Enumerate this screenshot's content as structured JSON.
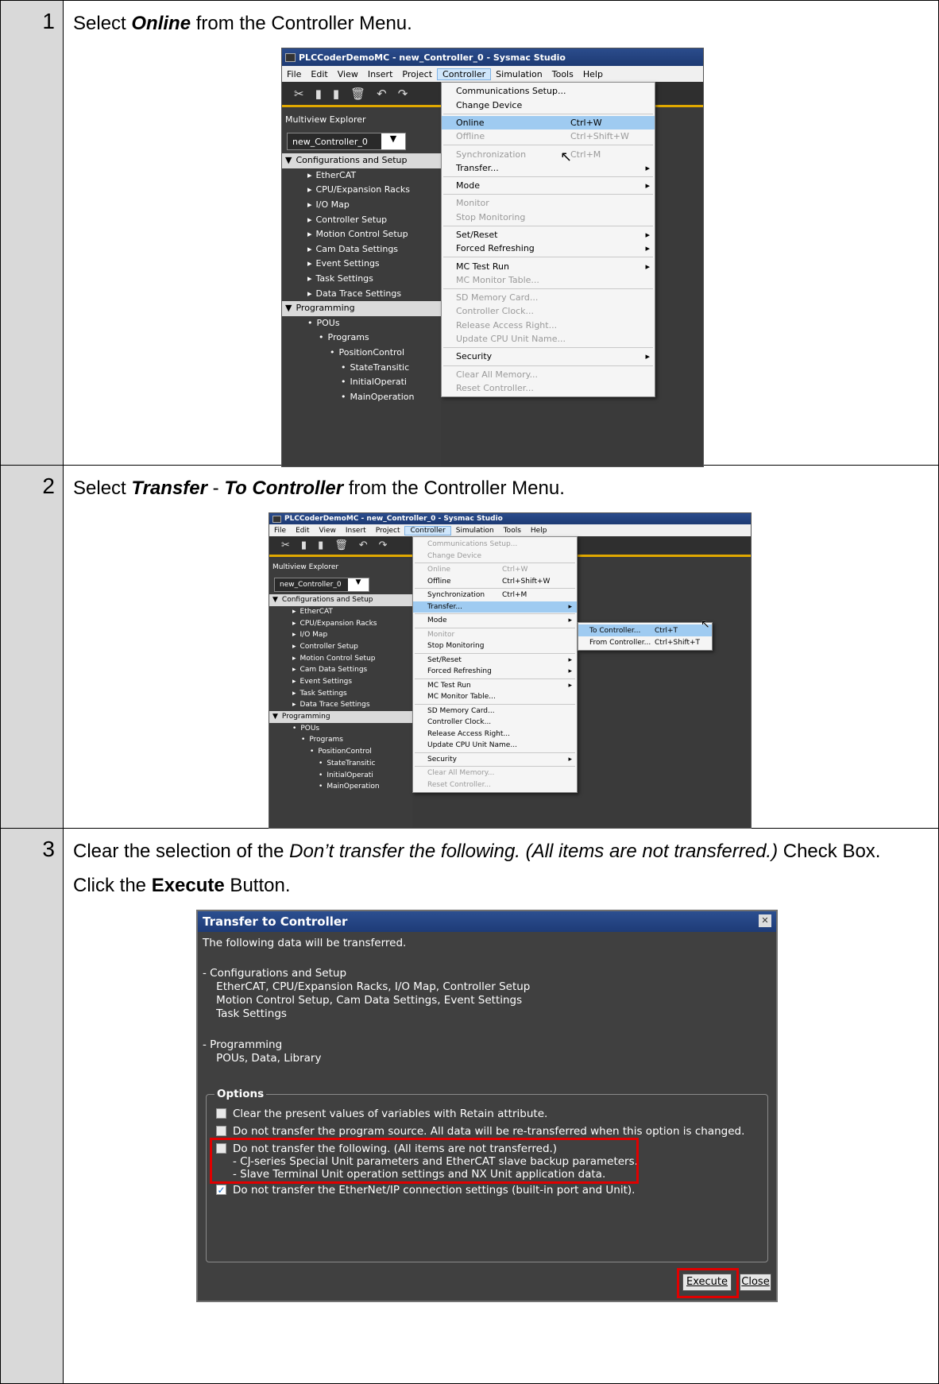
{
  "steps": [
    {
      "number": "1",
      "instruction": {
        "pre": "Select ",
        "strong": "Online",
        "post": " from the Controller Menu."
      },
      "screenshot": {
        "title": "PLCCoderDemoMC - new_Controller_0 - Sysmac Studio",
        "menubar": [
          "File",
          "Edit",
          "View",
          "Insert",
          "Project",
          "Controller",
          "Simulation",
          "Tools",
          "Help"
        ],
        "explorer_header": "Multiview Explorer",
        "combo_value": "new_Controller_0",
        "tree": [
          {
            "label": "Configurations and Setup",
            "group": true
          },
          {
            "label": "EtherCAT"
          },
          {
            "label": "CPU/Expansion Racks"
          },
          {
            "label": "I/O Map"
          },
          {
            "label": "Controller Setup"
          },
          {
            "label": "Motion Control Setup"
          },
          {
            "label": "Cam Data Settings"
          },
          {
            "label": "Event Settings"
          },
          {
            "label": "Task Settings"
          },
          {
            "label": "Data Trace Settings"
          },
          {
            "label": "Programming",
            "group": true
          },
          {
            "label": "POUs"
          },
          {
            "label": "Programs"
          },
          {
            "label": "PositionControl"
          },
          {
            "label": "StateTransitic"
          },
          {
            "label": "InitialOperati"
          },
          {
            "label": "MainOperation"
          }
        ],
        "menu": [
          {
            "label": "Communications Setup...",
            "shortcut": "",
            "state": "normal"
          },
          {
            "label": "Change Device",
            "shortcut": "",
            "state": "normal",
            "sep_after": true
          },
          {
            "label": "Online",
            "shortcut": "Ctrl+W",
            "state": "highlight"
          },
          {
            "label": "Offline",
            "shortcut": "Ctrl+Shift+W",
            "state": "disabled",
            "sep_after": true
          },
          {
            "label": "Synchronization",
            "shortcut": "Ctrl+M",
            "state": "disabled"
          },
          {
            "label": "Transfer...",
            "shortcut": "",
            "state": "normal",
            "submenu": true,
            "sep_after": true
          },
          {
            "label": "Mode",
            "shortcut": "",
            "state": "normal",
            "submenu": true,
            "sep_after": true
          },
          {
            "label": "Monitor",
            "shortcut": "",
            "state": "disabled"
          },
          {
            "label": "Stop Monitoring",
            "shortcut": "",
            "state": "disabled",
            "sep_after": true
          },
          {
            "label": "Set/Reset",
            "shortcut": "",
            "state": "normal",
            "submenu": true
          },
          {
            "label": "Forced Refreshing",
            "shortcut": "",
            "state": "normal",
            "submenu": true,
            "sep_after": true
          },
          {
            "label": "MC Test Run",
            "shortcut": "",
            "state": "normal",
            "submenu": true
          },
          {
            "label": "MC Monitor Table...",
            "shortcut": "",
            "state": "disabled",
            "sep_after": true
          },
          {
            "label": "SD Memory Card...",
            "shortcut": "",
            "state": "disabled"
          },
          {
            "label": "Controller Clock...",
            "shortcut": "",
            "state": "disabled"
          },
          {
            "label": "Release Access Right...",
            "shortcut": "",
            "state": "disabled"
          },
          {
            "label": "Update CPU Unit Name...",
            "shortcut": "",
            "state": "disabled",
            "sep_after": true
          },
          {
            "label": "Security",
            "shortcut": "",
            "state": "normal",
            "submenu": true,
            "sep_after": true
          },
          {
            "label": "Clear All Memory...",
            "shortcut": "",
            "state": "disabled"
          },
          {
            "label": "Reset Controller...",
            "shortcut": "",
            "state": "disabled"
          }
        ]
      }
    },
    {
      "number": "2",
      "instruction": {
        "pre": "Select ",
        "strong": "Transfer",
        "mid": " - ",
        "strong2": "To Controller",
        "post": " from the Controller Menu."
      },
      "screenshot": {
        "title": "PLCCoderDemoMC - new_Controller_0 - Sysmac Studio",
        "menubar": [
          "File",
          "Edit",
          "View",
          "Insert",
          "Project",
          "Controller",
          "Simulation",
          "Tools",
          "Help"
        ],
        "explorer_header": "Multiview Explorer",
        "combo_value": "new_Controller_0",
        "menu": [
          {
            "label": "Communications Setup...",
            "shortcut": "",
            "state": "disabled"
          },
          {
            "label": "Change Device",
            "shortcut": "",
            "state": "disabled",
            "sep_after": true
          },
          {
            "label": "Online",
            "shortcut": "Ctrl+W",
            "state": "disabled"
          },
          {
            "label": "Offline",
            "shortcut": "Ctrl+Shift+W",
            "state": "normal",
            "sep_after": true
          },
          {
            "label": "Synchronization",
            "shortcut": "Ctrl+M",
            "state": "normal"
          },
          {
            "label": "Transfer...",
            "shortcut": "",
            "state": "highlight",
            "submenu": true,
            "sep_after": true
          },
          {
            "label": "Mode",
            "shortcut": "",
            "state": "normal",
            "submenu": true,
            "sep_after": true
          },
          {
            "label": "Monitor",
            "shortcut": "",
            "state": "disabled"
          },
          {
            "label": "Stop Monitoring",
            "shortcut": "",
            "state": "normal",
            "sep_after": true
          },
          {
            "label": "Set/Reset",
            "shortcut": "",
            "state": "normal",
            "submenu": true
          },
          {
            "label": "Forced Refreshing",
            "shortcut": "",
            "state": "normal",
            "submenu": true,
            "sep_after": true
          },
          {
            "label": "MC Test Run",
            "shortcut": "",
            "state": "normal",
            "submenu": true
          },
          {
            "label": "MC Monitor Table...",
            "shortcut": "",
            "state": "normal",
            "sep_after": true
          },
          {
            "label": "SD Memory Card...",
            "shortcut": "",
            "state": "normal"
          },
          {
            "label": "Controller Clock...",
            "shortcut": "",
            "state": "normal"
          },
          {
            "label": "Release Access Right...",
            "shortcut": "",
            "state": "normal"
          },
          {
            "label": "Update CPU Unit Name...",
            "shortcut": "",
            "state": "normal",
            "sep_after": true
          },
          {
            "label": "Security",
            "shortcut": "",
            "state": "normal",
            "submenu": true,
            "sep_after": true
          },
          {
            "label": "Clear All Memory...",
            "shortcut": "",
            "state": "disabled"
          },
          {
            "label": "Reset Controller...",
            "shortcut": "",
            "state": "disabled"
          }
        ],
        "submenu": [
          {
            "label": "To Controller...",
            "shortcut": "Ctrl+T",
            "state": "highlight"
          },
          {
            "label": "From Controller...",
            "shortcut": "Ctrl+Shift+T",
            "state": "normal"
          }
        ]
      }
    },
    {
      "number": "3",
      "instruction_lines": {
        "line1_pre": "Clear the selection of the ",
        "line1_italic": "Don’t transfer the following. (All items are not transferred.)",
        "line1_post": " Check Box.",
        "line2_pre": "Click the ",
        "line2_strong": "Execute",
        "line2_post": " Button."
      },
      "dialog": {
        "title": "Transfer to Controller",
        "intro": "The following data will be transferred.",
        "block1": "- Configurations and Setup\n    EtherCAT, CPU/Expansion Racks, I/O Map, Controller Setup\n    Motion Control Setup, Cam Data Settings, Event Settings\n    Task Settings",
        "block2": "- Programming\n    POUs, Data, Library",
        "options_label": "Options",
        "options": [
          {
            "label": "Clear the present values of variables with Retain attribute.",
            "checked": false
          },
          {
            "label": "Do not transfer the program source. All data will be re-transferred when this option is changed.",
            "checked": false
          },
          {
            "label": "Do not transfer the following. (All items are not transferred.)\n- CJ-series Special Unit parameters and EtherCAT slave backup parameters.\n- Slave Terminal Unit operation settings and NX Unit application data.",
            "checked": false
          },
          {
            "label": "Do not transfer the EtherNet/IP connection settings (built-in port and Unit).",
            "checked": true
          }
        ],
        "execute_label": "Execute",
        "close_label": "Close"
      }
    }
  ],
  "colors": {
    "highlight": "#e00000",
    "number_column": "#d9d9d9",
    "title_blue": "#2b4c8c"
  }
}
